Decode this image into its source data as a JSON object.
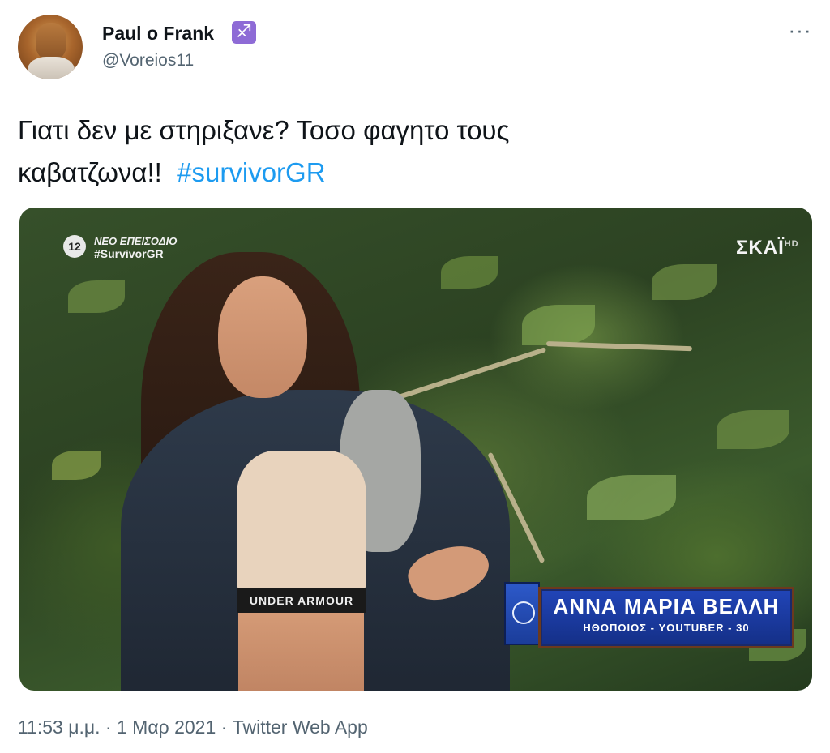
{
  "author": {
    "display_name": "Paul o Frank",
    "badge_glyph": "♐",
    "handle": "@Voreios11"
  },
  "menu": {
    "more_glyph": "···"
  },
  "tweet": {
    "text_line1": "Γιατι δεν με στηριξανε? Τοσο φαγητο τους",
    "text_line2": "καβατζωνα!!",
    "hashtag": "#survivorGR"
  },
  "media": {
    "channel_number": "12",
    "overlay_line1": "ΝΕΟ ΕΠΕΙΣΟΔΙΟ",
    "overlay_line2": "#SurvivorGR",
    "broadcaster": "ΣΚΑΪ",
    "broadcaster_suffix": "HD",
    "shirt_text": "UNDER ARMOUR",
    "contestant_name": "ΑΝΝΑ ΜΑΡΙΑ ΒΕΛΛΗ",
    "contestant_info": "ΗΘΟΠΟΙΟΣ - YOUTUBER - 30"
  },
  "meta": {
    "time": "11:53 μ.μ.",
    "date": "1 Μαρ 2021",
    "source": "Twitter Web App",
    "separator": "·"
  }
}
